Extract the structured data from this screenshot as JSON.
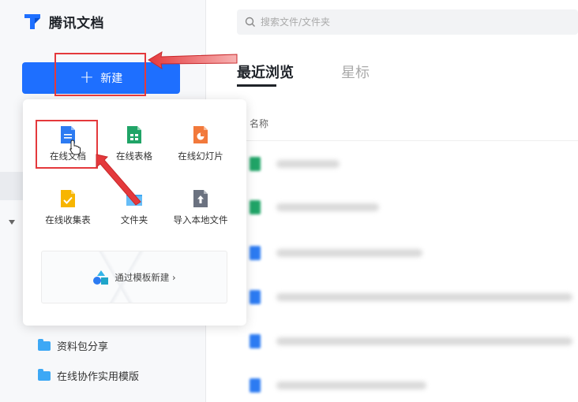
{
  "app": {
    "logo_text": "腾讯文档"
  },
  "sidebar": {
    "new_button_label": "新建",
    "folders": [
      {
        "label": "资料包分享"
      },
      {
        "label": "在线协作实用模版"
      }
    ]
  },
  "search": {
    "placeholder": "搜索文件/文件夹"
  },
  "tabs": [
    {
      "label": "最近浏览",
      "active": true
    },
    {
      "label": "星标",
      "active": false
    }
  ],
  "file_list": {
    "column_name": "名称"
  },
  "new_menu": {
    "items": [
      {
        "label": "在线文档",
        "icon": "doc-icon"
      },
      {
        "label": "在线表格",
        "icon": "sheet-icon"
      },
      {
        "label": "在线幻灯片",
        "icon": "slides-icon"
      },
      {
        "label": "在线收集表",
        "icon": "form-icon"
      },
      {
        "label": "文件夹",
        "icon": "folder-icon"
      },
      {
        "label": "导入本地文件",
        "icon": "upload-icon"
      }
    ],
    "template_label": "通过模板新建 ›"
  },
  "colors": {
    "primary": "#1e6fff",
    "doc": "#2c7bf2",
    "sheet": "#20a467",
    "slides": "#f2793b",
    "form": "#f7b500",
    "folder": "#3da8f5",
    "upload": "#6b7280",
    "annotation": "#e4393c"
  }
}
